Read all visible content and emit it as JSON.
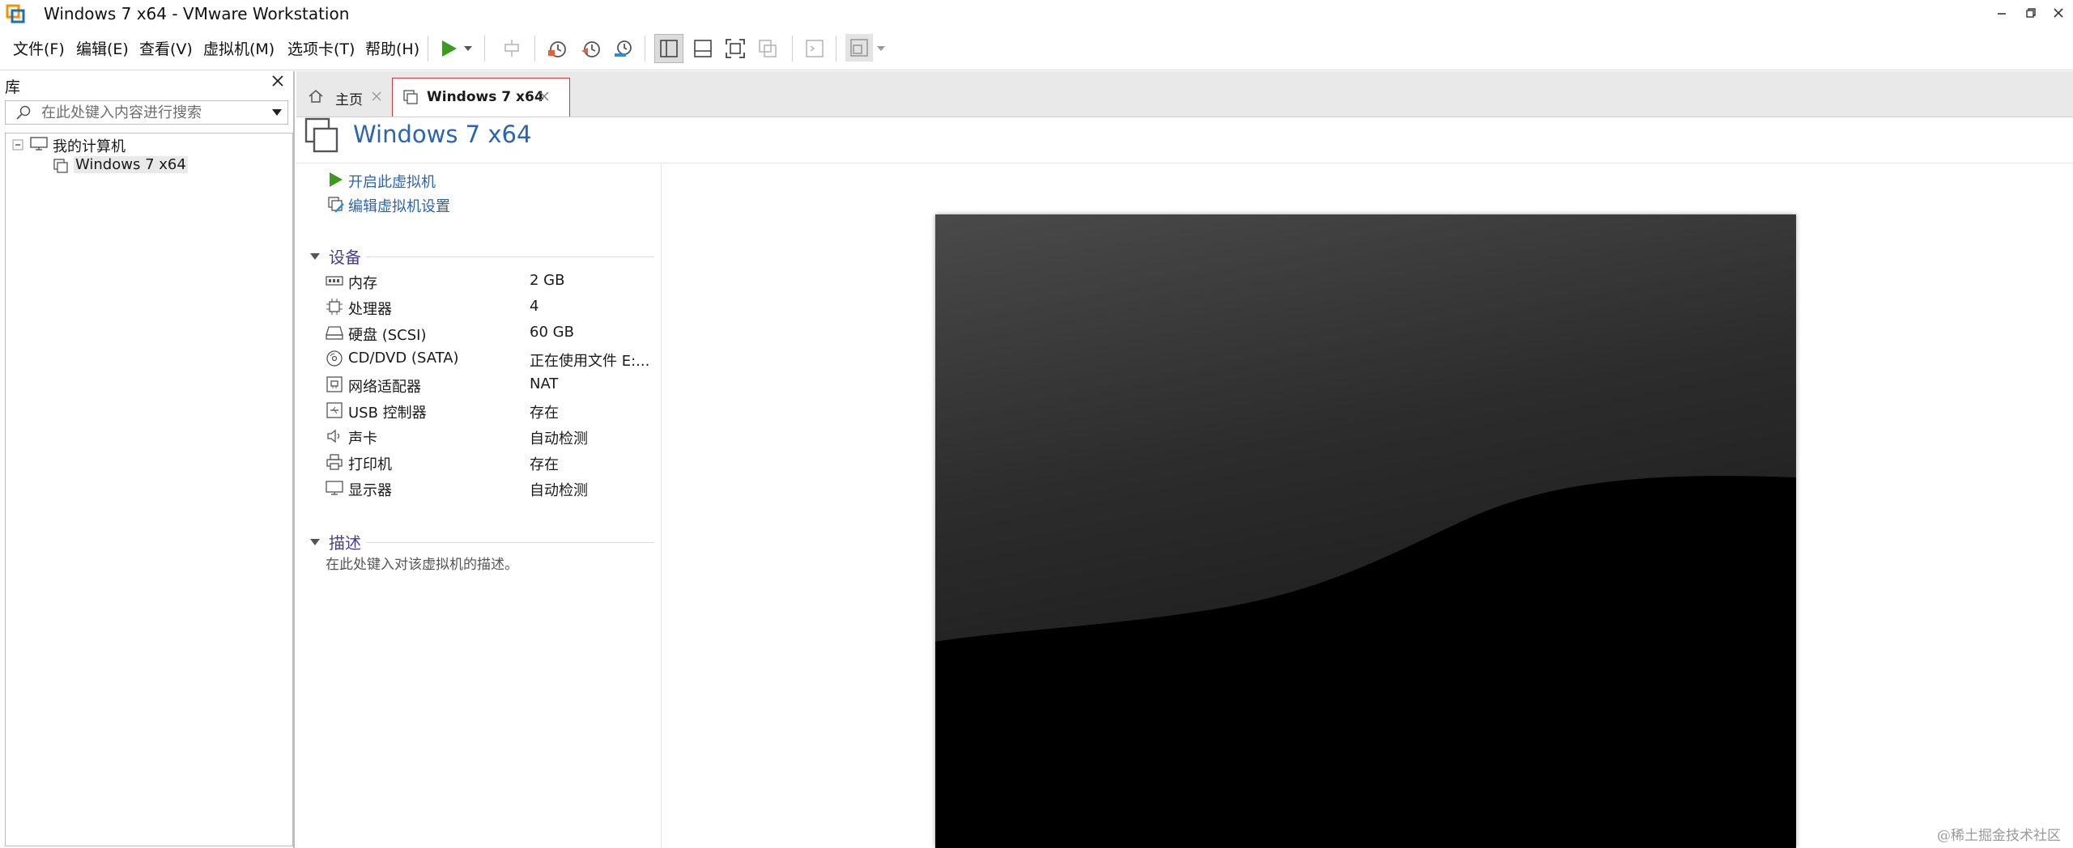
{
  "window": {
    "title": "Windows 7 x64 - VMware Workstation",
    "controls": [
      "minimize-icon",
      "restore-icon",
      "close-icon"
    ]
  },
  "menu": {
    "items": [
      "文件(F)",
      "编辑(E)",
      "查看(V)",
      "虚拟机(M)",
      "选项卡(T)",
      "帮助(H)"
    ]
  },
  "toolbar": {
    "buttons": [
      "play-icon",
      "dropdown-icon",
      "send-keys-icon",
      "snapshot-icon",
      "revert-snapshot-icon",
      "snapshot-manager-icon",
      "show-library-icon",
      "show-thumbnail-icon",
      "fullscreen-icon",
      "unity-icon",
      "console-icon",
      "view-stretch-icon"
    ],
    "accent_play": "#3c9a1f"
  },
  "library": {
    "title": "库",
    "search_placeholder": "在此处键入内容进行搜索",
    "tree": {
      "root": "我的计算机",
      "children": [
        "Windows 7 x64"
      ]
    }
  },
  "tabs": [
    {
      "label": "主页",
      "active": false
    },
    {
      "label": "Windows 7 x64",
      "active": true
    }
  ],
  "vm": {
    "title": "Windows 7 x64",
    "actions": [
      "开启此虚拟机",
      "编辑虚拟机设置"
    ],
    "devices_section": "设备",
    "devices": [
      {
        "name": "内存",
        "value": "2 GB",
        "icon": "memory-icon"
      },
      {
        "name": "处理器",
        "value": "4",
        "icon": "cpu-icon"
      },
      {
        "name": "硬盘 (SCSI)",
        "value": "60 GB",
        "icon": "hard-disk-icon"
      },
      {
        "name": "CD/DVD (SATA)",
        "value": "正在使用文件 E:...",
        "icon": "cd-dvd-icon"
      },
      {
        "name": "网络适配器",
        "value": "NAT",
        "icon": "network-adapter-icon"
      },
      {
        "name": "USB 控制器",
        "value": "存在",
        "icon": "usb-icon"
      },
      {
        "name": "声卡",
        "value": "自动检测",
        "icon": "sound-card-icon"
      },
      {
        "name": "打印机",
        "value": "存在",
        "icon": "printer-icon"
      },
      {
        "name": "显示器",
        "value": "自动检测",
        "icon": "display-icon"
      }
    ],
    "description_section": "描述",
    "description_placeholder": "在此处键入对该虚拟机的描述。"
  },
  "watermark": "@稀土掘金技术社区",
  "colors": {
    "link_blue": "#2b64b3",
    "section_purple": "#4a3d8f",
    "highlight_border": "#d03a3a"
  }
}
